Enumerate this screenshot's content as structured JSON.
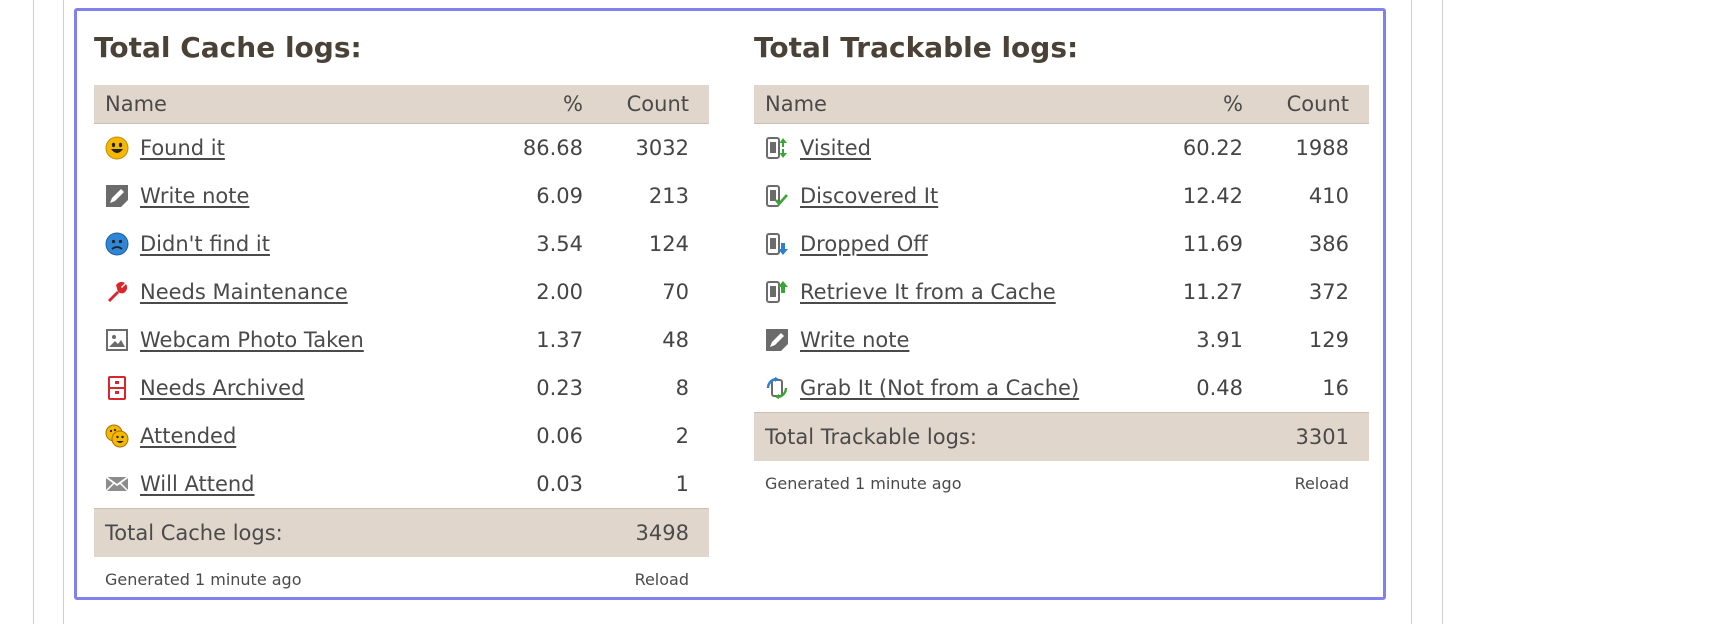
{
  "cache": {
    "title": "Total Cache logs:",
    "headers": {
      "name": "Name",
      "pct": "%",
      "count": "Count"
    },
    "rows": [
      {
        "icon": "smiley-icon",
        "name": "Found it",
        "pct": "86.68",
        "count": "3032"
      },
      {
        "icon": "write-note-icon",
        "name": "Write note",
        "pct": "6.09",
        "count": "213"
      },
      {
        "icon": "sad-face-icon",
        "name": "Didn't find it",
        "pct": "3.54",
        "count": "124"
      },
      {
        "icon": "wrench-icon",
        "name": "Needs Maintenance",
        "pct": "2.00",
        "count": "70"
      },
      {
        "icon": "photo-icon",
        "name": "Webcam Photo Taken",
        "pct": "1.37",
        "count": "48"
      },
      {
        "icon": "archive-icon",
        "name": "Needs Archived",
        "pct": "0.23",
        "count": "8"
      },
      {
        "icon": "attended-icon",
        "name": "Attended",
        "pct": "0.06",
        "count": "2"
      },
      {
        "icon": "envelope-icon",
        "name": "Will Attend",
        "pct": "0.03",
        "count": "1"
      }
    ],
    "total_label": "Total Cache logs:",
    "total_count": "3498",
    "generated": "Generated 1 minute ago",
    "reload": "Reload"
  },
  "trackable": {
    "title": "Total Trackable logs:",
    "headers": {
      "name": "Name",
      "pct": "%",
      "count": "Count"
    },
    "rows": [
      {
        "icon": "visited-icon",
        "name": "Visited",
        "pct": "60.22",
        "count": "1988"
      },
      {
        "icon": "discovered-icon",
        "name": "Discovered It",
        "pct": "12.42",
        "count": "410"
      },
      {
        "icon": "dropped-off-icon",
        "name": "Dropped Off",
        "pct": "11.69",
        "count": "386"
      },
      {
        "icon": "retrieve-icon",
        "name": "Retrieve It from a Cache",
        "pct": "11.27",
        "count": "372"
      },
      {
        "icon": "write-note-icon",
        "name": "Write note",
        "pct": "3.91",
        "count": "129"
      },
      {
        "icon": "grab-icon",
        "name": "Grab It (Not from a Cache)",
        "pct": "0.48",
        "count": "16"
      }
    ],
    "total_label": "Total Trackable logs:",
    "total_count": "3301",
    "generated": "Generated 1 minute ago",
    "reload": "Reload"
  },
  "colors": {
    "panel_border": "#8080ee",
    "header_bg": "#e1d6cb",
    "title_text": "#4a4236"
  }
}
